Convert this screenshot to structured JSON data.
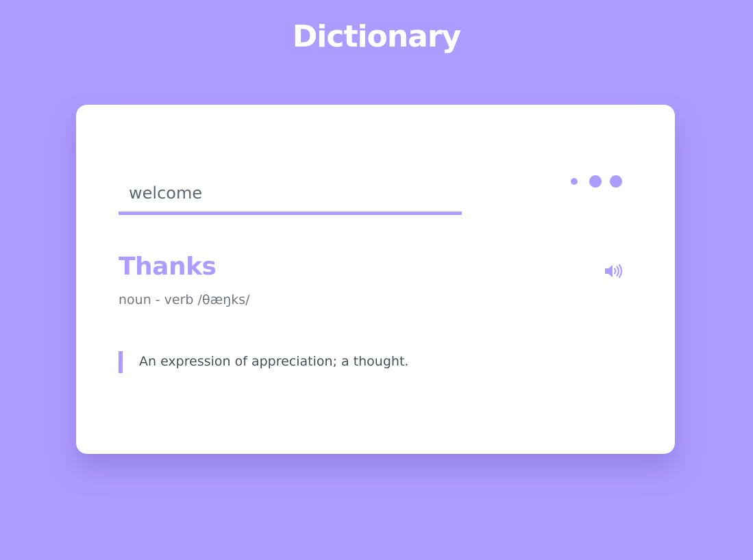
{
  "app": {
    "title": "Dictionary"
  },
  "search": {
    "value": "welcome"
  },
  "result": {
    "word": "Thanks",
    "part_of_speech": "noun - verb",
    "phonetic": "/θæŋks/",
    "definition": "An expression of appreciation; a thought."
  },
  "icons": {
    "loading": "loading-dots-icon",
    "speaker": "speaker-icon"
  },
  "colors": {
    "background": "#ad9cff",
    "accent": "#ad9cff",
    "card": "#ffffff"
  }
}
